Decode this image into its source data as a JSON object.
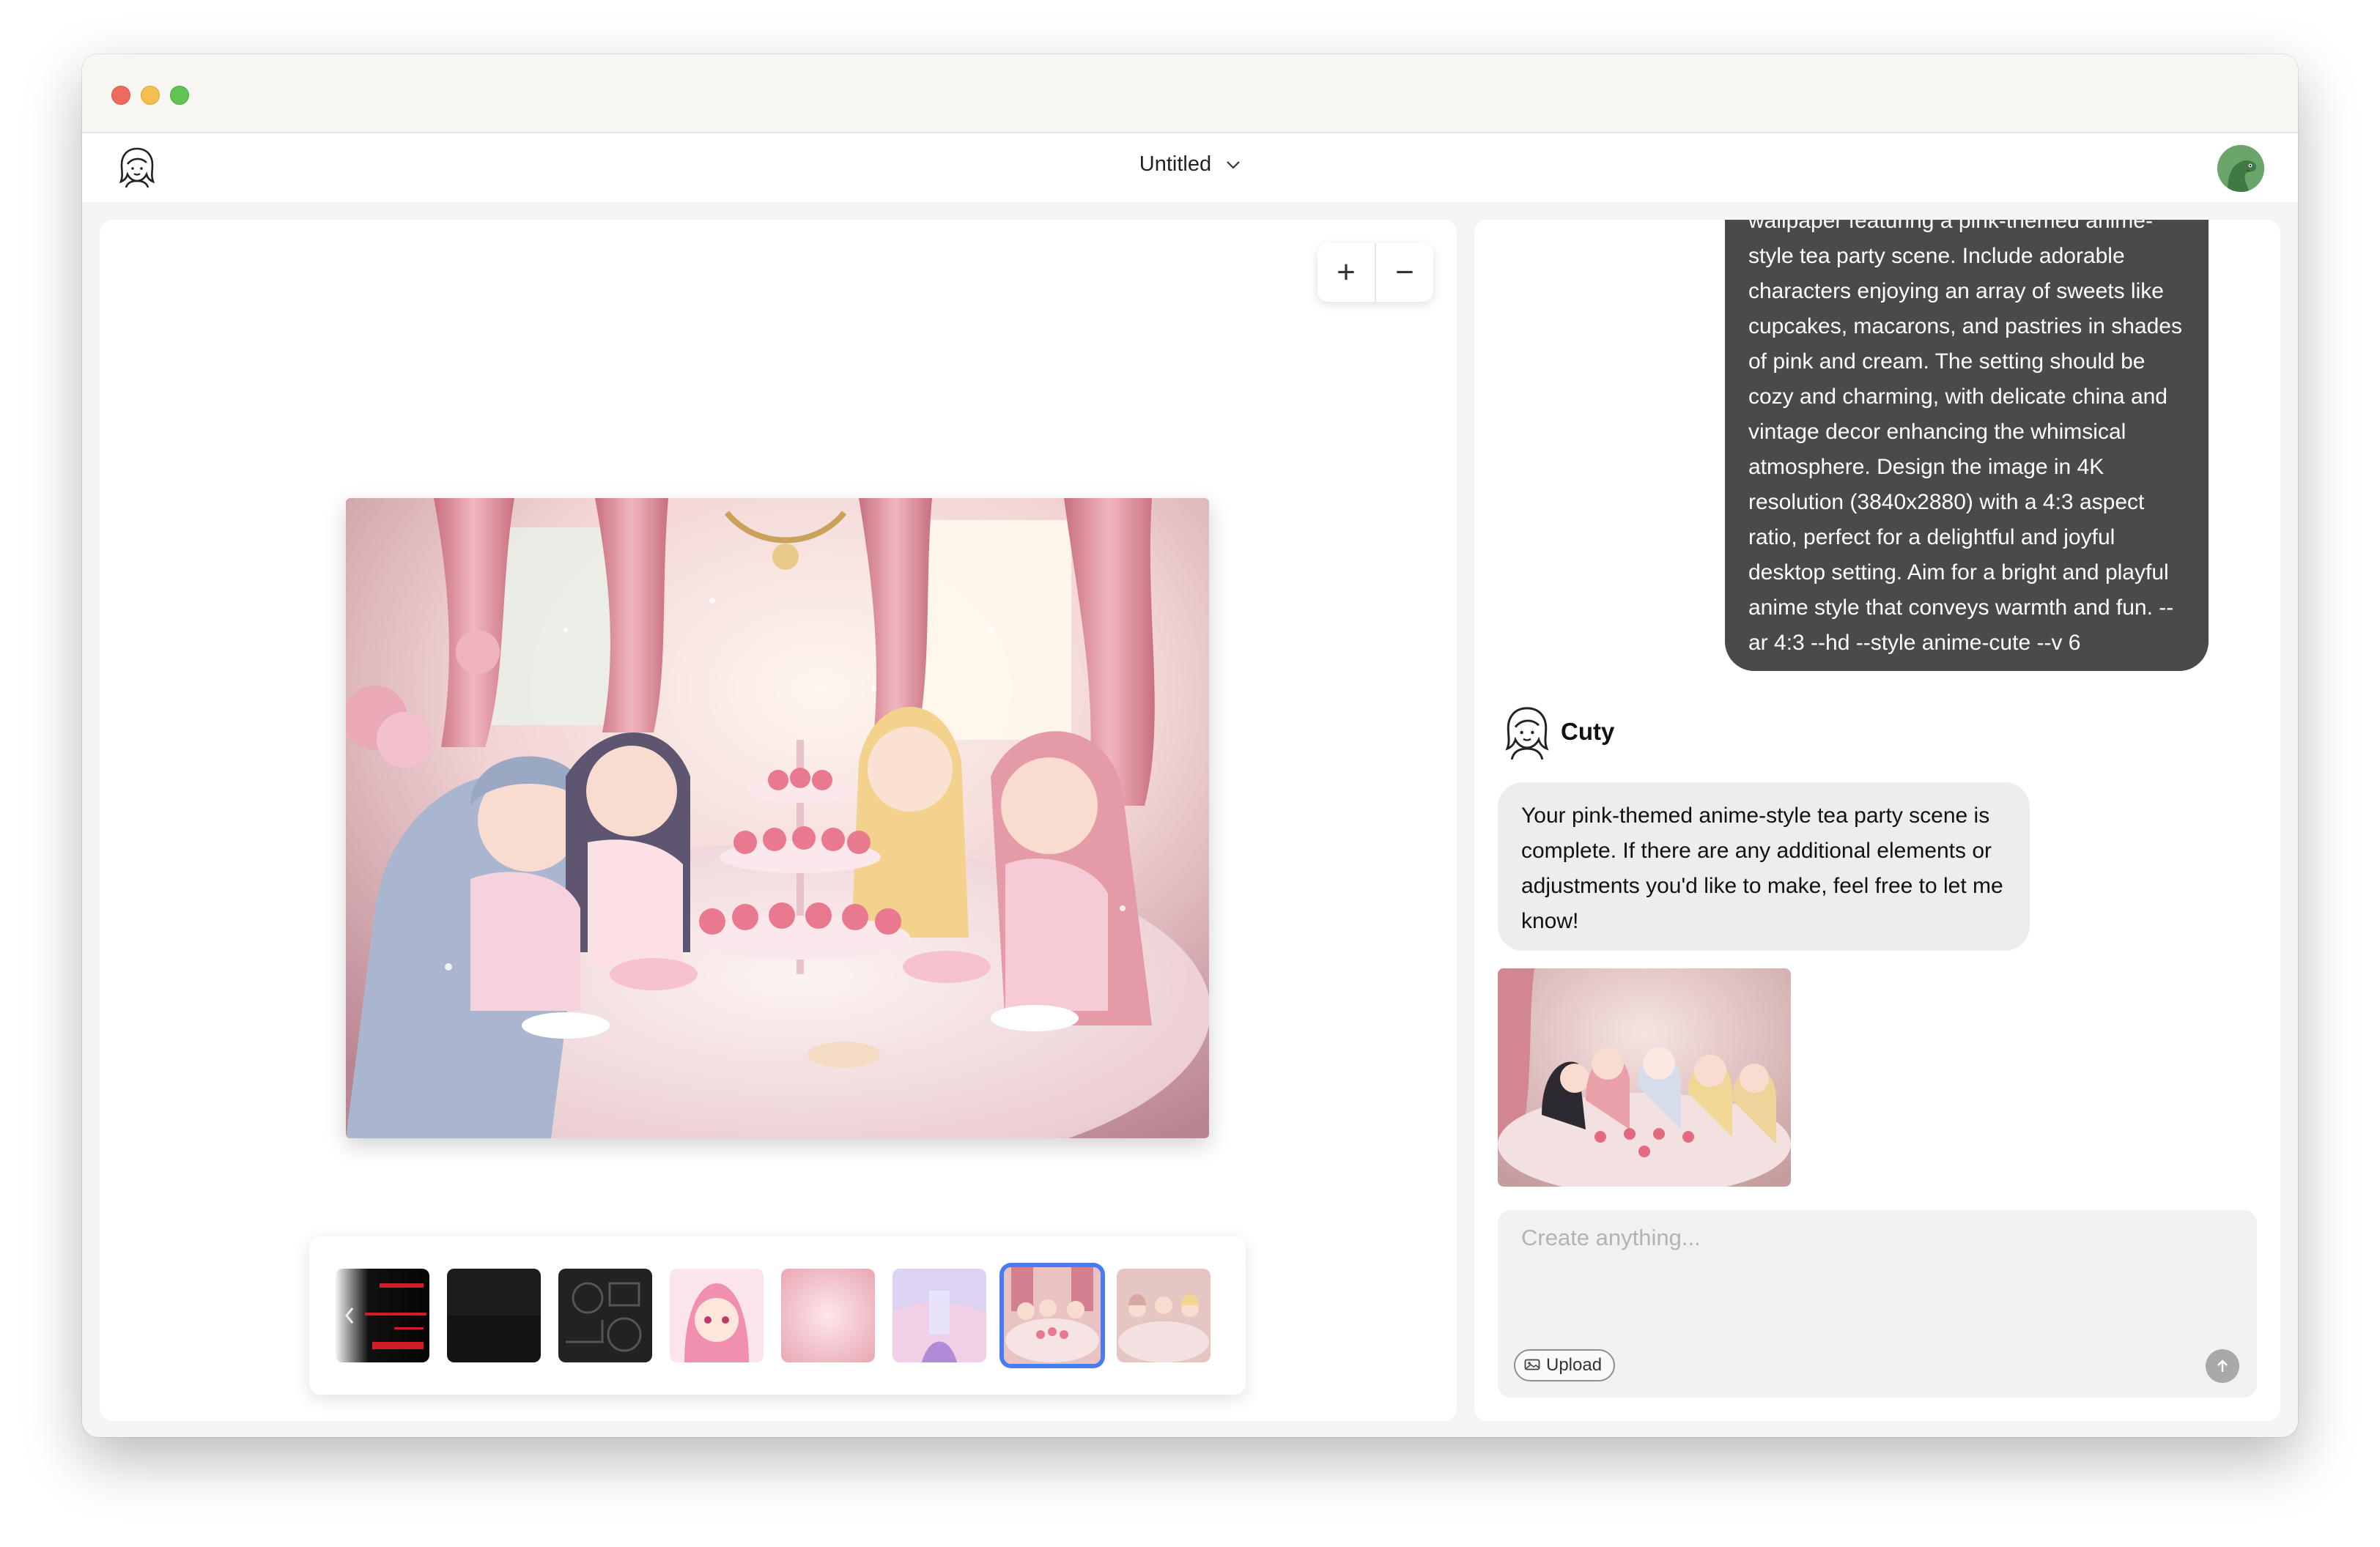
{
  "header": {
    "doc_title": "Untitled"
  },
  "canvas": {
    "zoom_in_label": "+",
    "zoom_out_label": "−",
    "main_image": "anime-tea-party-image",
    "thumbnails": [
      {
        "name": "thumb-red-glitch"
      },
      {
        "name": "thumb-black"
      },
      {
        "name": "thumb-dark-circuit"
      },
      {
        "name": "thumb-pink-anime-girl"
      },
      {
        "name": "thumb-pink-bokeh"
      },
      {
        "name": "thumb-pastel-castle"
      },
      {
        "name": "thumb-tea-party",
        "selected": true
      },
      {
        "name": "thumb-tea-party-alt"
      }
    ]
  },
  "chat": {
    "user_prompt": "Generate a high-resolution desktop wallpaper featuring a pink-themed anime-style tea party scene. Include adorable characters enjoying an array of sweets like cupcakes, macarons, and pastries in shades of pink and cream. The setting should be cozy and charming, with delicate china and vintage decor enhancing the whimsical atmosphere. Design the image in 4K resolution (3840x2880) with a 4:3 aspect ratio, perfect for a delightful and joyful desktop setting. Aim for a bright and playful anime style that conveys warmth and fun. --ar 4:3 --hd --style anime-cute --v 6",
    "bot_name": "Cuty",
    "bot_reply": "Your pink-themed anime-style tea party scene is complete. If there are any additional elements or adjustments you'd like to make, feel free to let me know!",
    "composer": {
      "placeholder": "Create anything...",
      "upload_label": "Upload"
    }
  },
  "colors": {
    "accent": "#4a7cf0",
    "user_bubble": "#4a4a4a",
    "bot_bubble": "#ededed"
  }
}
